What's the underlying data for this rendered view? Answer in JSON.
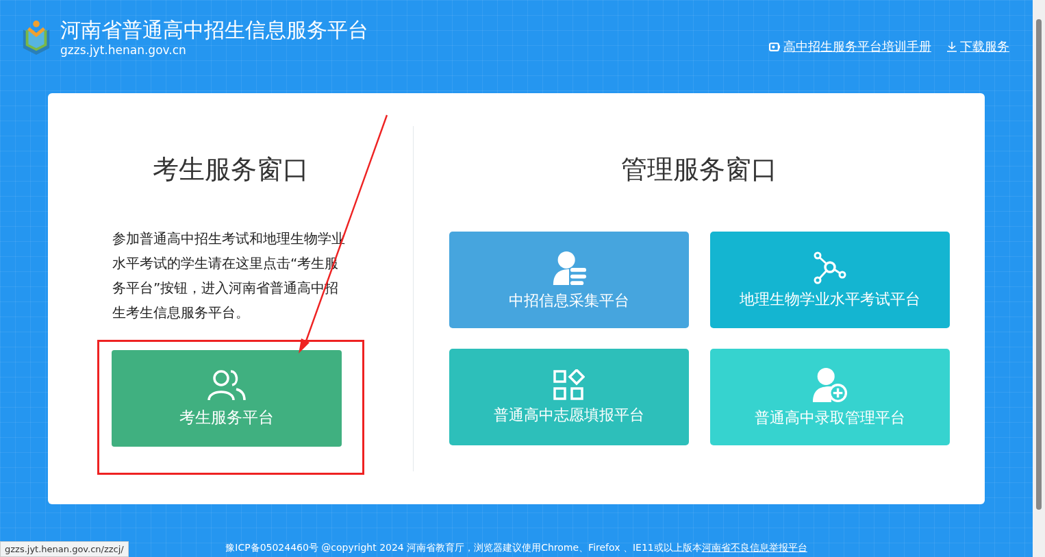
{
  "header": {
    "title": "河南省普通高中招生信息服务平台",
    "domain": "gzzs.jyt.henan.gov.cn",
    "links": [
      {
        "kind": "manual",
        "label": "高中招生服务平台培训手册"
      },
      {
        "kind": "download",
        "label": "下载服务"
      }
    ]
  },
  "student_window": {
    "heading": "考生服务窗口",
    "description": "参加普通高中招生考试和地理生物学业水平考试的学生请在这里点击“考生服务平台”按钮，进入河南省普通高中招生考生信息服务平台。",
    "button": {
      "label": "考生服务平台",
      "highlighted": true
    }
  },
  "admin_window": {
    "heading": "管理服务窗口",
    "tiles": [
      {
        "kind": "info",
        "label": "中招信息采集平台",
        "color": "#46a5de"
      },
      {
        "kind": "network",
        "label": "地理生物学业水平考试平台",
        "color": "#14b5d1"
      },
      {
        "kind": "apps",
        "label": "普通高中志愿填报平台",
        "color": "#2dbfba"
      },
      {
        "kind": "add-user",
        "label": "普通高中录取管理平台",
        "color": "#36d3cf"
      }
    ]
  },
  "footer": {
    "text": "豫ICP备05024460号 @copyright 2024 河南省教育厅，浏览器建议使用Chrome、Firefox 、IE11或以上版本",
    "link": "河南省不良信息举报平台"
  },
  "status_url": "gzzs.jyt.henan.gov.cn/zzcj/"
}
